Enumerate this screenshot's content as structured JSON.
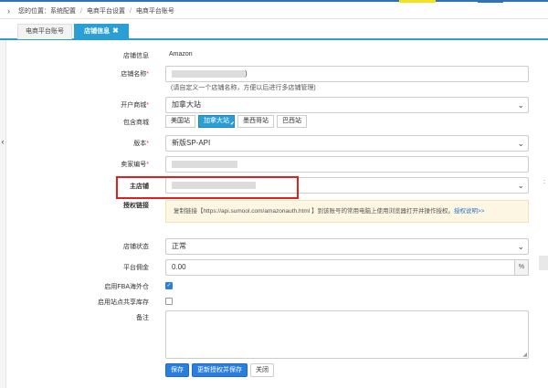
{
  "breadcrumb": {
    "prefix": "您的位置：",
    "items": [
      "系统配置",
      "电商平台设置",
      "电商平台账号"
    ]
  },
  "tabs": [
    {
      "label": "电商平台账号"
    },
    {
      "label": "店铺信息"
    }
  ],
  "form": {
    "store_info": {
      "label": "店铺信息",
      "value": "Amazon"
    },
    "store_name": {
      "label": "店铺名称",
      "value_suffix": ")",
      "hint": "(请自定义一个店铺名称，方便以后进行多店铺管理)"
    },
    "marketplace": {
      "label": "开户商城",
      "value": "加拿大站"
    },
    "included": {
      "label": "包含商城",
      "options": [
        "美国站",
        "加拿大站",
        "墨西哥站",
        "巴西站"
      ],
      "selected": "加拿大站"
    },
    "version": {
      "label": "版本",
      "value": "新版SP-API"
    },
    "seller_id": {
      "label": "卖家编号"
    },
    "main_store": {
      "label": "主店铺"
    },
    "auth_link": {
      "label": "授权链接",
      "text": "复制链接【https://api.sumool.com/amazonauth.html 】到该账号的常用电脑上使用浏览器打开并操作授权。",
      "link": "授权说明>>"
    },
    "store_status": {
      "label": "店铺状态",
      "value": "正常"
    },
    "commission": {
      "label": "平台佣金",
      "value": "0.00",
      "unit": "%"
    },
    "fba_overseas": {
      "label": "启用FBA海外仓",
      "checked": true
    },
    "shared_stock": {
      "label": "启用站点共享库存",
      "checked": false
    },
    "remarks": {
      "label": "备注",
      "value": ""
    }
  },
  "buttons": {
    "save": "保存",
    "update_auth_save": "更新授权并保存",
    "close": "关闭"
  },
  "colors": {
    "accent": "#2a9fd6",
    "primary_button": "#2a7de1",
    "highlight_border": "#e02020",
    "required_mark": "#ee3333"
  }
}
